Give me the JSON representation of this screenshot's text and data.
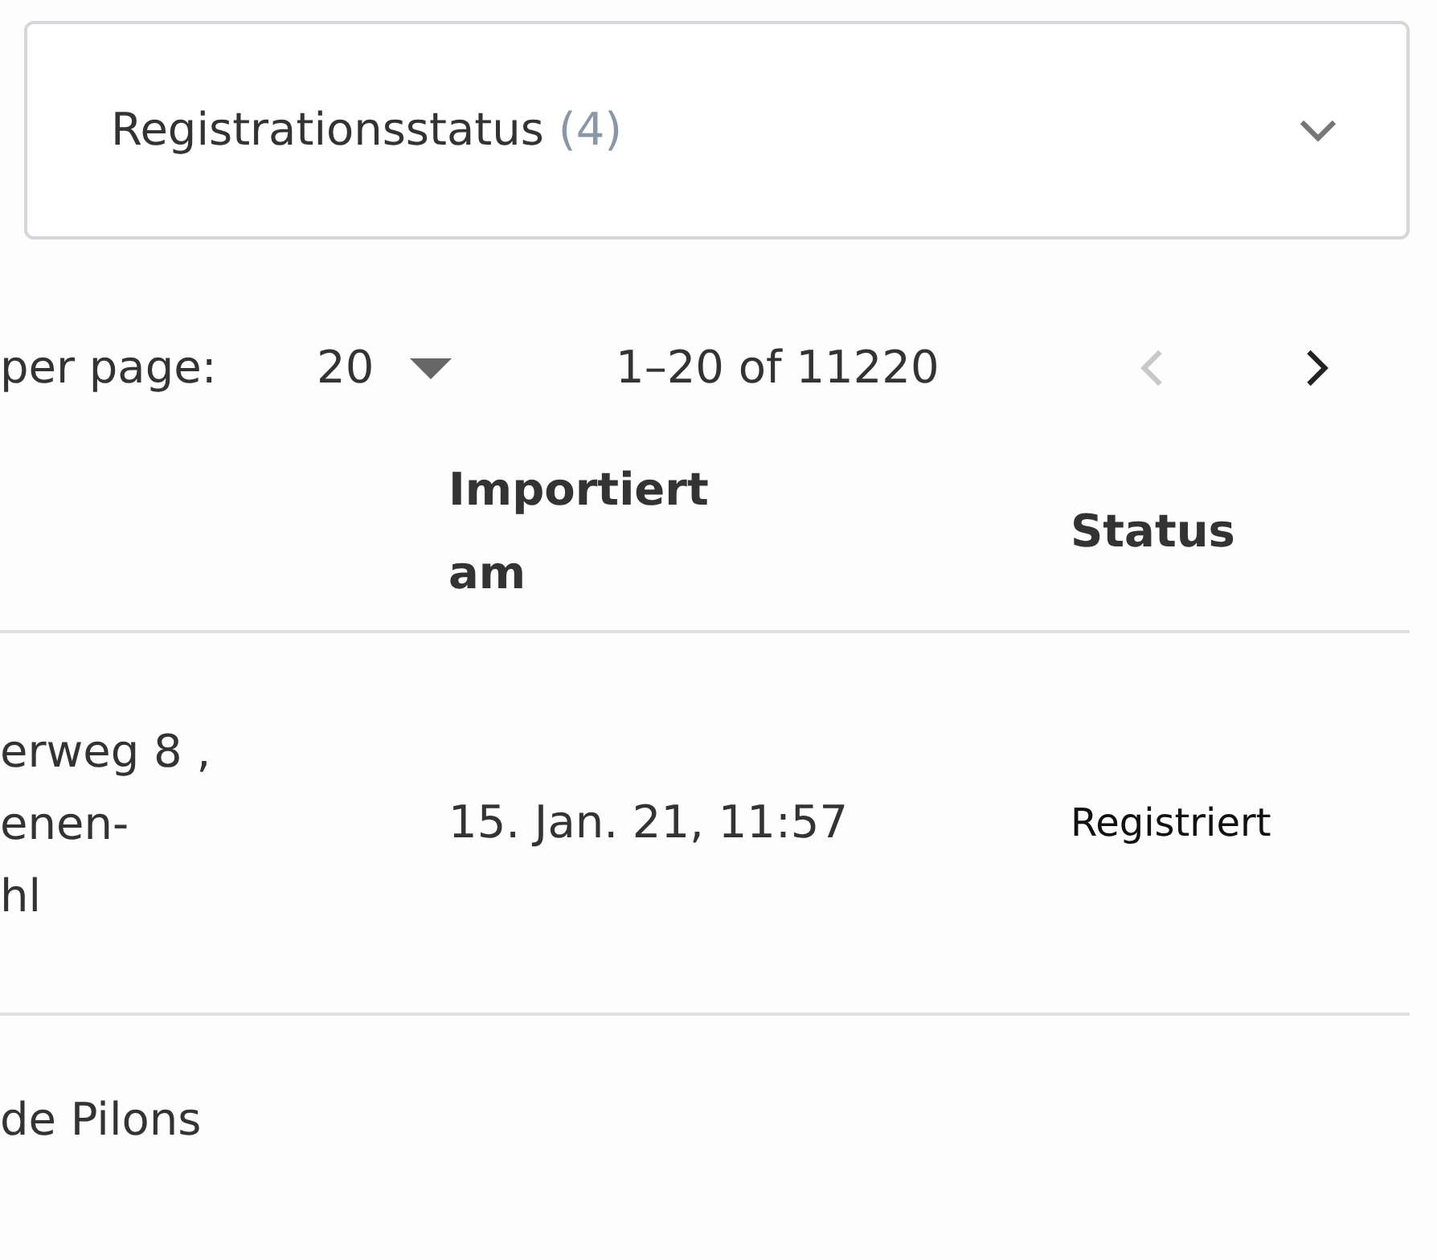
{
  "filter": {
    "label": "Registrationsstatus",
    "count": "(4)",
    "expanded": false
  },
  "pagination": {
    "per_page_label": "per page:",
    "per_page": "20",
    "range": "1–20 of 11220",
    "prev_disabled": true,
    "next_disabled": false
  },
  "table": {
    "columns": [
      "Importiert am",
      "Status"
    ],
    "rows": [
      {
        "address": [
          "erweg 8 ,",
          "enen-",
          "hl"
        ],
        "imported": "15. Jan. 21, 11:57",
        "status": "Registriert"
      },
      {
        "address": [
          "de Pilons"
        ]
      }
    ]
  }
}
